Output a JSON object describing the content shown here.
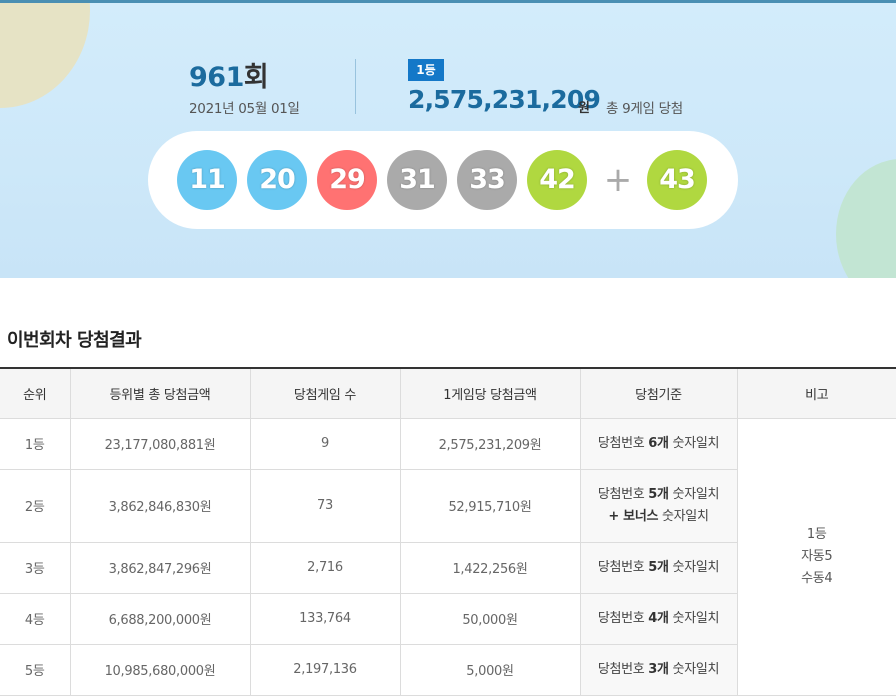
{
  "draw": {
    "round": "961",
    "round_suffix": "회",
    "date": "2021년 05월 01일"
  },
  "first_prize": {
    "badge": "1등",
    "amount": "2,575,231,209",
    "unit": "원",
    "winners_text": "총 9게임 당첨"
  },
  "numbers": {
    "main": [
      {
        "value": "11",
        "color": "#69c8f2"
      },
      {
        "value": "20",
        "color": "#69c8f2"
      },
      {
        "value": "29",
        "color": "#ff7272"
      },
      {
        "value": "31",
        "color": "#aaaaaa"
      },
      {
        "value": "33",
        "color": "#aaaaaa"
      },
      {
        "value": "42",
        "color": "#b0d840"
      }
    ],
    "plus": "+",
    "bonus": {
      "value": "43",
      "color": "#b0d840"
    }
  },
  "results": {
    "title": "이번회차 당첨결과",
    "headers": [
      "순위",
      "등위별 총 당첨금액",
      "당첨게임 수",
      "1게임당 당첨금액",
      "당첨기준",
      "비고"
    ],
    "rows": [
      {
        "rank": "1등",
        "total": "23,177,080,881원",
        "games": "9",
        "per_game": "2,575,231,209원",
        "crit": {
          "pre": "당첨번호 ",
          "count": "6개",
          "post": " 숫자일치"
        }
      },
      {
        "rank": "2등",
        "total": "3,862,846,830원",
        "games": "73",
        "per_game": "52,915,710원",
        "crit": {
          "pre": "당첨번호 ",
          "count": "5개",
          "post": " 숫자일치",
          "line2_pre": "+ ",
          "line2_bold": "보너스",
          "line2_post": " 숫자일치"
        }
      },
      {
        "rank": "3등",
        "total": "3,862,847,296원",
        "games": "2,716",
        "per_game": "1,422,256원",
        "crit": {
          "pre": "당첨번호 ",
          "count": "5개",
          "post": " 숫자일치"
        }
      },
      {
        "rank": "4등",
        "total": "6,688,200,000원",
        "games": "133,764",
        "per_game": "50,000원",
        "crit": {
          "pre": "당첨번호 ",
          "count": "4개",
          "post": " 숫자일치"
        }
      },
      {
        "rank": "5등",
        "total": "10,985,680,000원",
        "games": "2,197,136",
        "per_game": "5,000원",
        "crit": {
          "pre": "당첨번호 ",
          "count": "3개",
          "post": " 숫자일치"
        }
      }
    ],
    "note": {
      "line1": "1등",
      "line2": "자동5",
      "line3": "수동4"
    }
  }
}
